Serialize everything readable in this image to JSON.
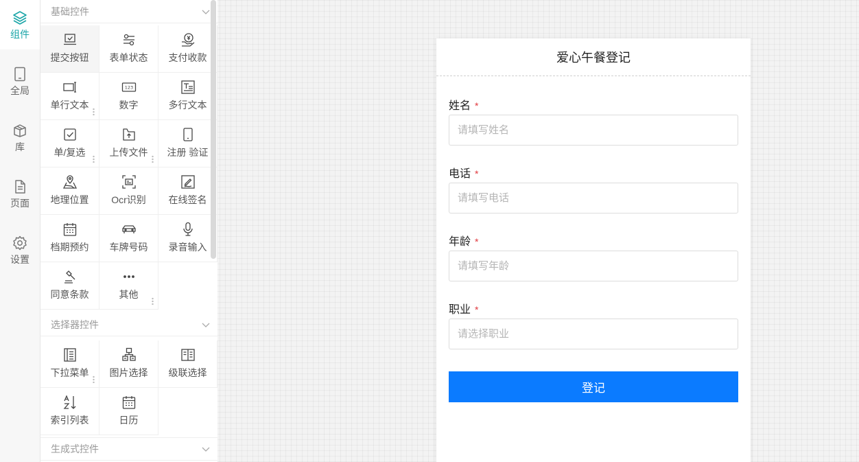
{
  "nav": {
    "items": [
      {
        "label": "组件",
        "icon": "layers-icon"
      },
      {
        "label": "全局",
        "icon": "tablet-icon"
      },
      {
        "label": "库",
        "icon": "box-icon"
      },
      {
        "label": "页面",
        "icon": "page-icon"
      },
      {
        "label": "设置",
        "icon": "gear-icon"
      }
    ]
  },
  "panel": {
    "sections": [
      {
        "title": "基础控件",
        "items": [
          {
            "label": "提交按钮",
            "icon": "submit-icon"
          },
          {
            "label": "表单状态",
            "icon": "toggle-icon"
          },
          {
            "label": "支付收款",
            "icon": "payment-icon"
          },
          {
            "label": "单行文本",
            "icon": "text-input-icon"
          },
          {
            "label": "数字",
            "icon": "number-icon"
          },
          {
            "label": "多行文本",
            "icon": "textarea-icon"
          },
          {
            "label": "单/复选",
            "icon": "checkbox-icon"
          },
          {
            "label": "上传文件",
            "icon": "upload-icon"
          },
          {
            "label": "注册 验证",
            "icon": "phone-icon"
          },
          {
            "label": "地理位置",
            "icon": "map-pin-icon"
          },
          {
            "label": "Ocr识别",
            "icon": "scan-icon"
          },
          {
            "label": "在线签名",
            "icon": "signature-icon"
          },
          {
            "label": "档期预约",
            "icon": "calendar-grid-icon"
          },
          {
            "label": "车牌号码",
            "icon": "car-icon"
          },
          {
            "label": "录音输入",
            "icon": "microphone-icon"
          },
          {
            "label": "同意条款",
            "icon": "gavel-icon"
          },
          {
            "label": "其他",
            "icon": "more-icon"
          }
        ]
      },
      {
        "title": "选择器控件",
        "items": [
          {
            "label": "下拉菜单",
            "icon": "dropdown-icon"
          },
          {
            "label": "图片选择",
            "icon": "image-select-icon"
          },
          {
            "label": "级联选择",
            "icon": "cascade-icon"
          },
          {
            "label": "索引列表",
            "icon": "sort-az-icon"
          },
          {
            "label": "日历",
            "icon": "calendar-icon"
          }
        ]
      },
      {
        "title": "生成式控件",
        "items": []
      }
    ]
  },
  "form": {
    "title": "爱心午餐登记",
    "required_mark": "*",
    "fields": [
      {
        "label": "姓名",
        "placeholder": "请填写姓名"
      },
      {
        "label": "电话",
        "placeholder": "请填写电话"
      },
      {
        "label": "年龄",
        "placeholder": "请填写年龄"
      },
      {
        "label": "职业",
        "placeholder": "请选择职业"
      }
    ],
    "submit_label": "登记"
  },
  "colors": {
    "accent": "#1aa5a8",
    "primary_button": "#0b7bff",
    "required": "#e0383e"
  }
}
